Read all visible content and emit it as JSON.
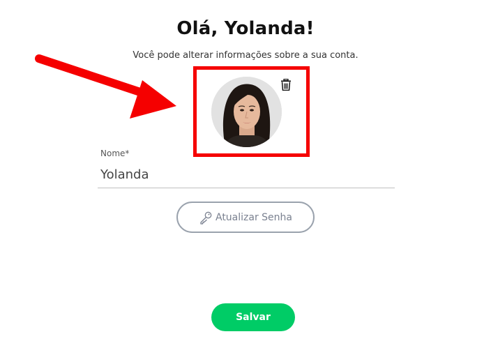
{
  "header": {
    "greeting": "Olá, Yolanda!",
    "subtitle": "Você pode alterar informações sobre a sua conta."
  },
  "profile": {
    "avatar_alt": "Foto de perfil de Yolanda",
    "avatar_icon": "user-photo",
    "delete_icon": "trash-icon"
  },
  "form": {
    "name_label": "Nome*",
    "name_value": "Yolanda"
  },
  "actions": {
    "update_password_label": "Atualizar Senha",
    "update_password_icon": "key-icon",
    "save_label": "Salvar"
  },
  "colors": {
    "accent_green": "#00cc66",
    "annotation_red": "#f50000",
    "button_border": "#9aa2ad"
  }
}
